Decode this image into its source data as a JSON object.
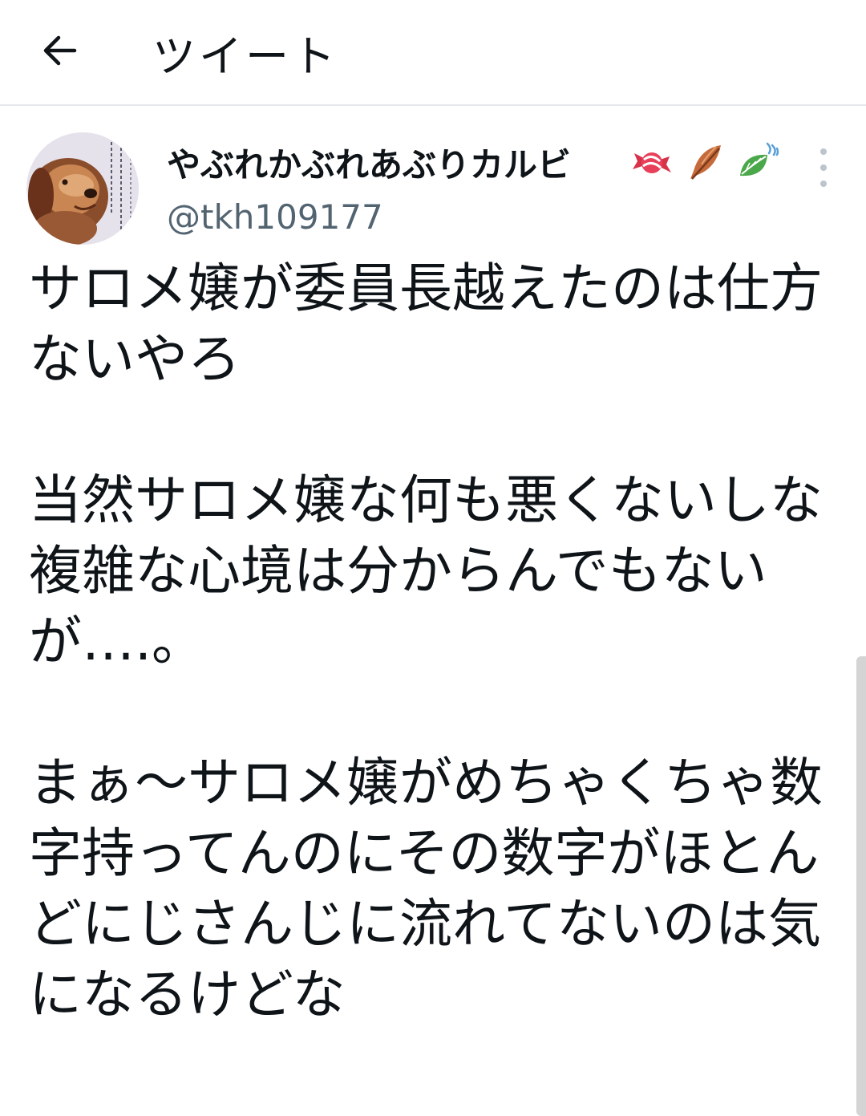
{
  "header": {
    "back_icon": "arrow-left-icon",
    "title": "ツイート"
  },
  "author": {
    "avatar_icon": "dog-avatar",
    "display_name": "やぶれかぶれあぶりカルビ",
    "badges": [
      "candy-emoji",
      "feather-emoji",
      "leaf-emoji"
    ],
    "handle": "@tkh109177",
    "more_icon": "more-vertical-icon"
  },
  "tweet": {
    "para1": "サロメ嬢が委員長越えたのは仕方ないやろ",
    "para2": "当然サロメ嬢な何も悪くないしな",
    "para3": "複雑な心境は分からんでもないが….。",
    "para4": "まぁ〜サロメ嬢がめちゃくちゃ数字持ってんのにその数字がほとんどにじさんじに流れてないのは気になるけどな"
  },
  "colors": {
    "text": "#0f1419",
    "secondary": "#536471",
    "divider": "#e6e9ec"
  }
}
